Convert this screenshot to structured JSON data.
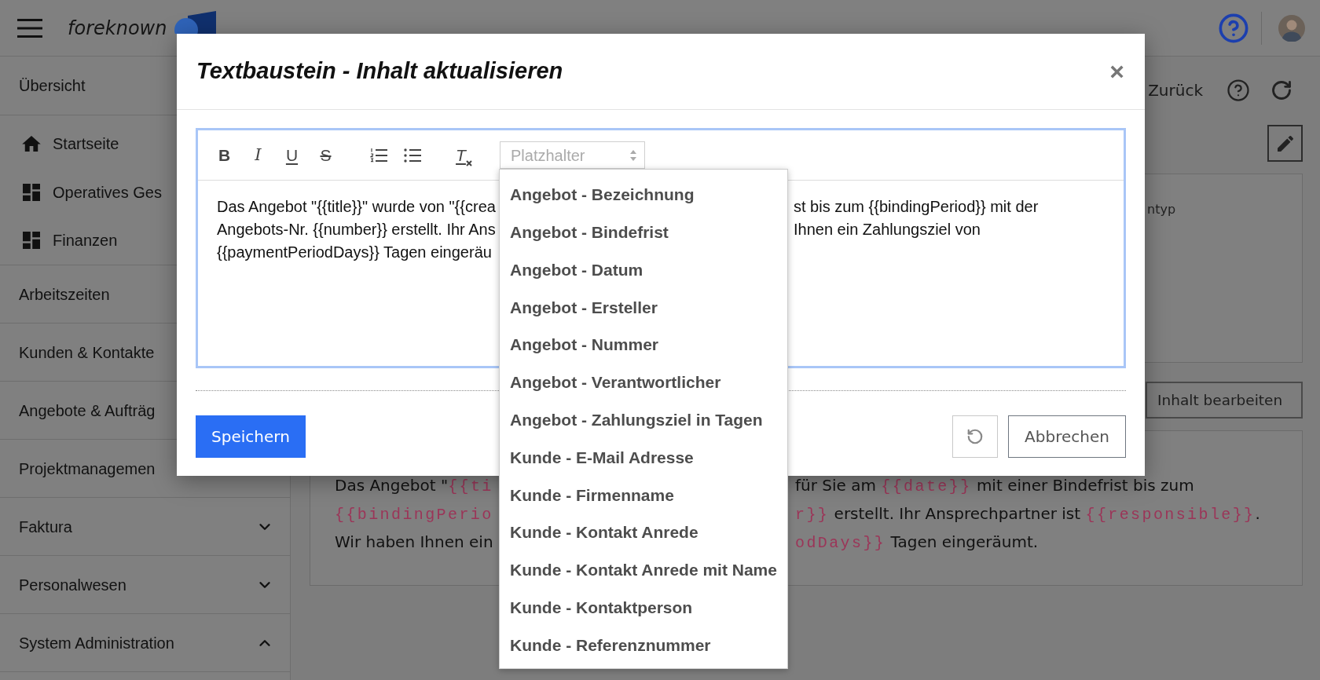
{
  "header": {
    "logo": "foreknown"
  },
  "sidebar": {
    "sections": [
      {
        "kind": "section",
        "label": "Übersicht",
        "children": [
          {
            "kind": "home",
            "label": "Startseite"
          },
          {
            "kind": "dashboard",
            "label": "Operatives Ges"
          },
          {
            "kind": "dashboard",
            "label": "Finanzen"
          }
        ]
      },
      {
        "kind": "link",
        "label": "Arbeitszeiten"
      },
      {
        "kind": "link",
        "label": "Kunden & Kontakte"
      },
      {
        "kind": "link",
        "label": "Angebote & Aufträg"
      },
      {
        "kind": "link",
        "label": "Projektmanagemen"
      },
      {
        "kind": "group",
        "label": "Faktura",
        "expanded": false
      },
      {
        "kind": "group",
        "label": "Personalwesen",
        "expanded": false
      },
      {
        "kind": "group",
        "label": "System Administration",
        "expanded": true
      }
    ]
  },
  "page": {
    "toolbar": {
      "back": "Zurück"
    },
    "details_panel": {
      "text": "ntyp"
    },
    "edit_button": "Inhalt bearbeiten",
    "preview": {
      "lines": [
        {
          "left": [
            {
              "kind": "text",
              "text": "Das Angebot \""
            },
            {
              "kind": "code",
              "text": "{{ti"
            }
          ],
          "right": [
            {
              "kind": "text",
              "text": "für Sie am "
            },
            {
              "kind": "code",
              "text": "{{date}}"
            },
            {
              "kind": "text",
              "text": " mit einer Bindefrist bis zum"
            }
          ]
        },
        {
          "left": [
            {
              "kind": "code",
              "text": "{{bindingPerio"
            }
          ],
          "right": [
            {
              "kind": "code",
              "text": "r}}"
            },
            {
              "kind": "text",
              "text": " erstellt. Ihr Ansprechpartner ist "
            },
            {
              "kind": "code",
              "text": "{{responsible}}"
            },
            {
              "kind": "text",
              "text": "."
            }
          ]
        },
        {
          "left": [
            {
              "kind": "text",
              "text": "Wir haben Ihnen ein"
            }
          ],
          "right": [
            {
              "kind": "code",
              "text": "odDays}}"
            },
            {
              "kind": "text",
              "text": " Tagen eingeräumt."
            }
          ]
        }
      ]
    }
  },
  "dialog": {
    "title": "Textbaustein - Inhalt aktualisieren",
    "close": "×",
    "editor": {
      "toolbar": [
        {
          "kind": "bold",
          "label": "B"
        },
        {
          "kind": "italic",
          "label": "I"
        },
        {
          "kind": "underline",
          "label": "U"
        },
        {
          "kind": "strike",
          "label": "S"
        },
        {
          "kind": "ordered"
        },
        {
          "kind": "bullet"
        },
        {
          "kind": "clean",
          "label": "T"
        }
      ],
      "placeholder_select": {
        "placeholder": "Platzhalter",
        "expanded": true,
        "options": [
          {
            "label": "Angebot - Bezeichnung",
            "selected": false
          },
          {
            "label": "Angebot - Bindefrist",
            "selected": false
          },
          {
            "label": "Angebot - Datum",
            "selected": false
          },
          {
            "label": "Angebot - Ersteller",
            "selected": false
          },
          {
            "label": "Angebot - Nummer",
            "selected": false
          },
          {
            "label": "Angebot - Verantwortlicher",
            "selected": false
          },
          {
            "label": "Angebot - Zahlungsziel in Tagen",
            "selected": false
          },
          {
            "label": "Kunde - E-Mail Adresse",
            "selected": false
          },
          {
            "label": "Kunde - Firmenname",
            "selected": false
          },
          {
            "label": "Kunde - Kontakt Anrede",
            "selected": false
          },
          {
            "label": "Kunde - Kontakt Anrede mit Name",
            "selected": false
          },
          {
            "label": "Kunde - Kontaktperson",
            "selected": false
          },
          {
            "label": "Kunde - Referenznummer",
            "selected": false
          }
        ]
      },
      "lines": [
        {
          "left": "Das Angebot \"{{title}}\" wurde von \"{{crea",
          "right": "st bis zum {{bindingPeriod}} mit der"
        },
        {
          "left": "Angebots-Nr. {{number}} erstellt. Ihr Ans",
          "right": "Ihnen ein Zahlungsziel von"
        },
        {
          "left": "{{paymentPeriodDays}} Tagen eingeräu"
        }
      ]
    },
    "buttons": {
      "save": "Speichern",
      "cancel": "Abbrechen"
    }
  }
}
